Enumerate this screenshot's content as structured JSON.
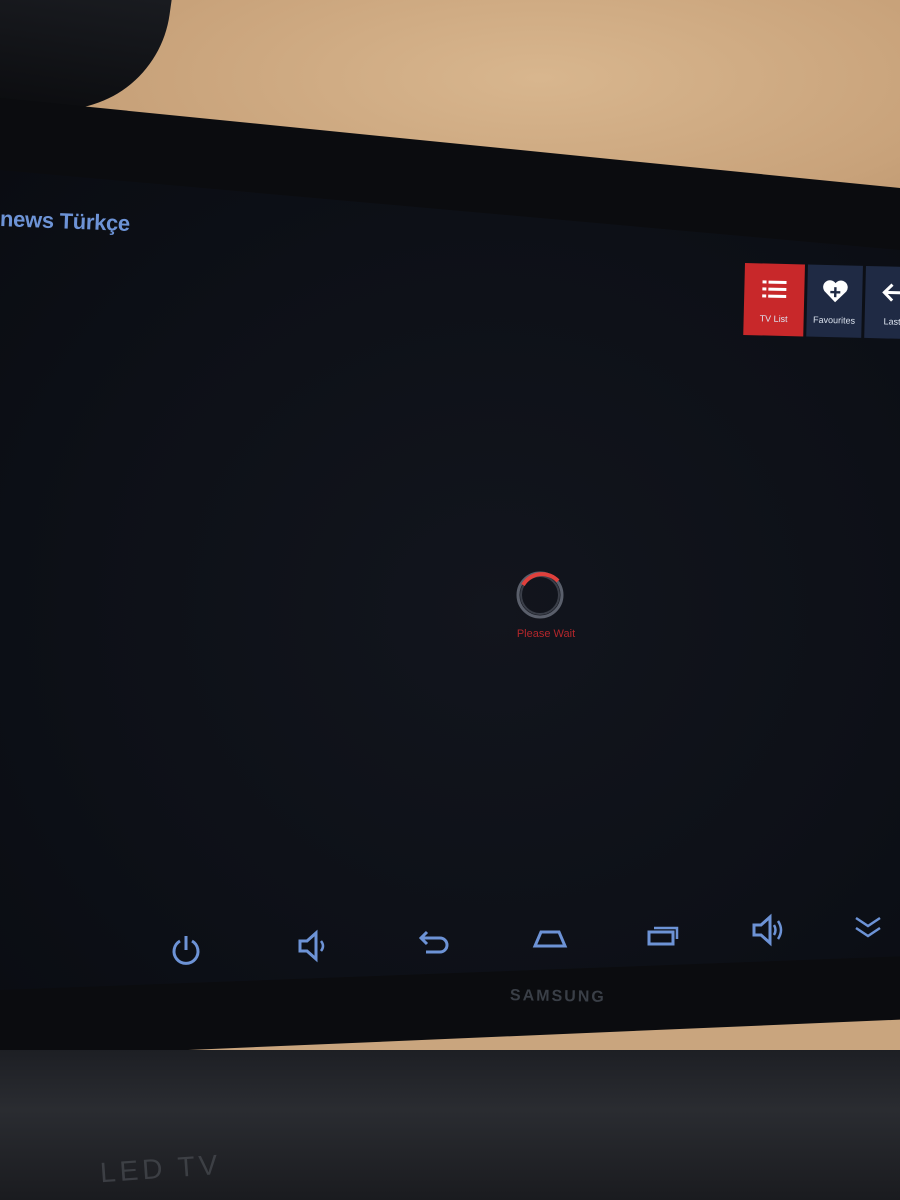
{
  "channel": {
    "title": "news Türkçe"
  },
  "top_menu": [
    {
      "label": "TV List",
      "icon": "list-icon",
      "active": true
    },
    {
      "label": "Favourites",
      "icon": "heart-plus-icon",
      "active": false
    },
    {
      "label": "Last",
      "icon": "arrow-left-icon",
      "active": false
    }
  ],
  "loading": {
    "text": "Please Wait",
    "color": "#d02a2e"
  },
  "nav_icons": [
    "power-icon",
    "volume-down-icon",
    "back-icon",
    "home-icon",
    "recent-apps-icon",
    "volume-up-icon",
    "collapse-icon"
  ],
  "monitor": {
    "brand": "SAMSUNG",
    "stand_label": "LED TV"
  },
  "colors": {
    "accent": "#c8282a",
    "menu_bg": "#1f2a44",
    "nav_icon": "#6d93d6"
  }
}
